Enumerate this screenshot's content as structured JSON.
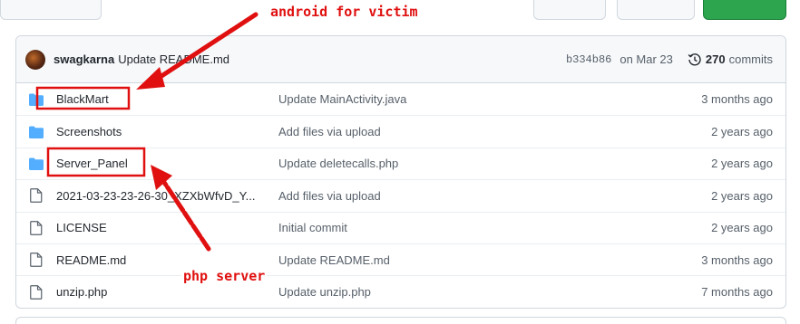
{
  "commit": {
    "author": "swagkarna",
    "message": "Update README.md",
    "sha": "b334b86",
    "date": "on Mar 23",
    "count": "270",
    "count_label": "commits"
  },
  "files": [
    {
      "type": "folder",
      "name": "BlackMart",
      "message": "Update MainActivity.java",
      "age": "3 months ago"
    },
    {
      "type": "folder",
      "name": "Screenshots",
      "message": "Add files via upload",
      "age": "2 years ago"
    },
    {
      "type": "folder",
      "name": "Server_Panel",
      "message": "Update deletecalls.php",
      "age": "2 years ago"
    },
    {
      "type": "file",
      "name": "2021-03-23-23-26-30_XZXbWfvD_Y...",
      "message": "Add files via upload",
      "age": "2 years ago"
    },
    {
      "type": "file",
      "name": "LICENSE",
      "message": "Initial commit",
      "age": "2 years ago"
    },
    {
      "type": "file",
      "name": "README.md",
      "message": "Update README.md",
      "age": "3 months ago"
    },
    {
      "type": "file",
      "name": "unzip.php",
      "message": "Update unzip.php",
      "age": "7 months ago"
    }
  ],
  "annotations": {
    "android": "android for victim",
    "php": "php server"
  },
  "colors": {
    "folder_icon": "#54aeff",
    "annotation_red": "#e01010"
  }
}
